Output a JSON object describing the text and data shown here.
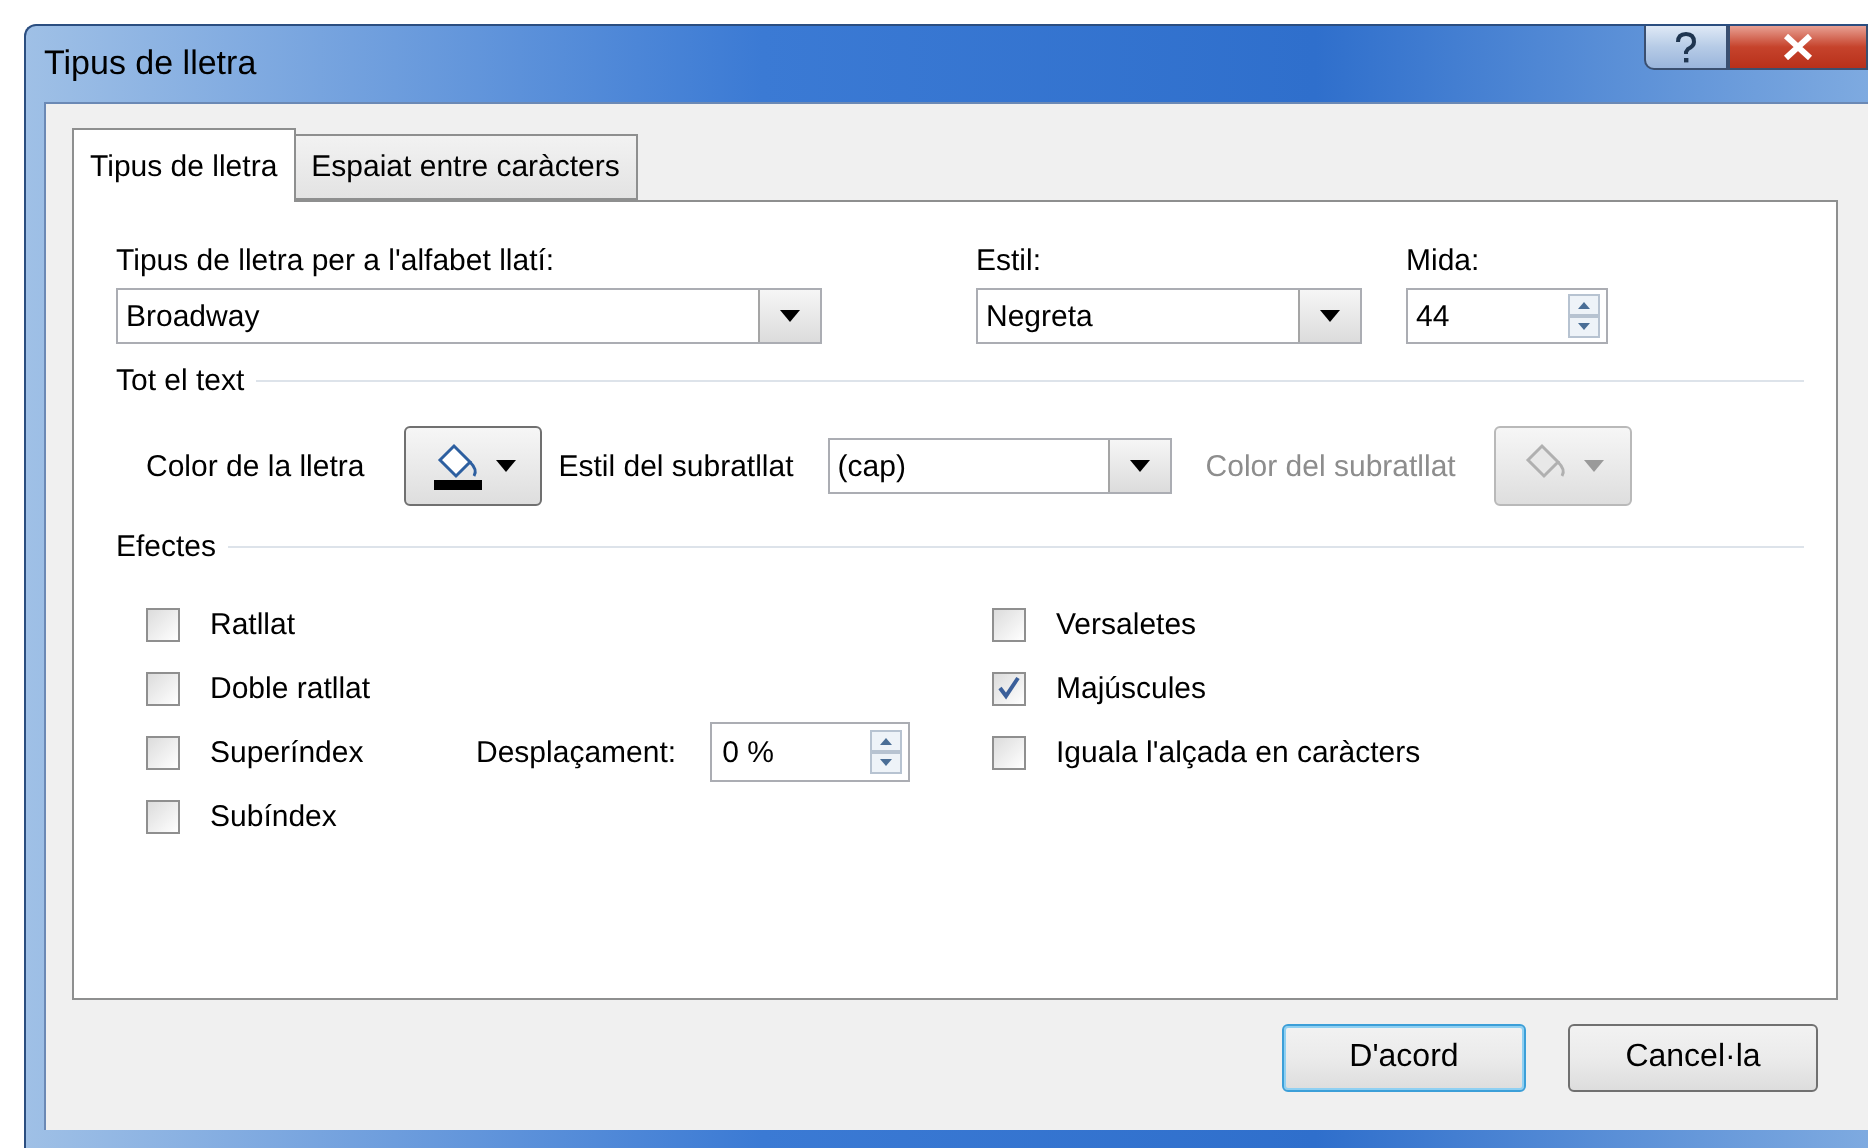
{
  "window": {
    "title": "Tipus de lletra"
  },
  "tabs": [
    {
      "label": "Tipus de lletra",
      "selected": true
    },
    {
      "label": "Espaiat entre caràcters",
      "selected": false
    }
  ],
  "font_fields": [
    {
      "kind": "dropdown",
      "label": "Tipus de lletra per a l'alfabet llatí:",
      "value": "Broadway"
    },
    {
      "kind": "dropdown",
      "label": "Estil:",
      "value": "Negreta"
    },
    {
      "kind": "spin",
      "label": "Mida:",
      "value": "44"
    }
  ],
  "all_text": {
    "title": "Tot el text",
    "font_color": {
      "label": "Color de la lletra",
      "disabled": false
    },
    "underline_style": {
      "label": "Estil del subratllat",
      "value": "(cap)"
    },
    "underline_color": {
      "label": "Color del subratllat",
      "disabled": true
    }
  },
  "effects": {
    "title": "Efectes",
    "left": [
      {
        "label": "Ratllat",
        "checked": false
      },
      {
        "label": "Doble ratllat",
        "checked": false
      },
      {
        "label": "Superíndex",
        "checked": false
      },
      {
        "label": "Subíndex",
        "checked": false
      }
    ],
    "right": [
      {
        "label": "Versaletes",
        "checked": false
      },
      {
        "label": "Majúscules",
        "checked": true
      },
      {
        "label": "Iguala l'alçada en caràcters",
        "checked": false
      }
    ],
    "offset": {
      "label": "Desplaçament:",
      "value": "0 %"
    }
  },
  "buttons": [
    {
      "label": "D'acord",
      "default": true
    },
    {
      "label": "Cancel·la",
      "default": false
    }
  ]
}
